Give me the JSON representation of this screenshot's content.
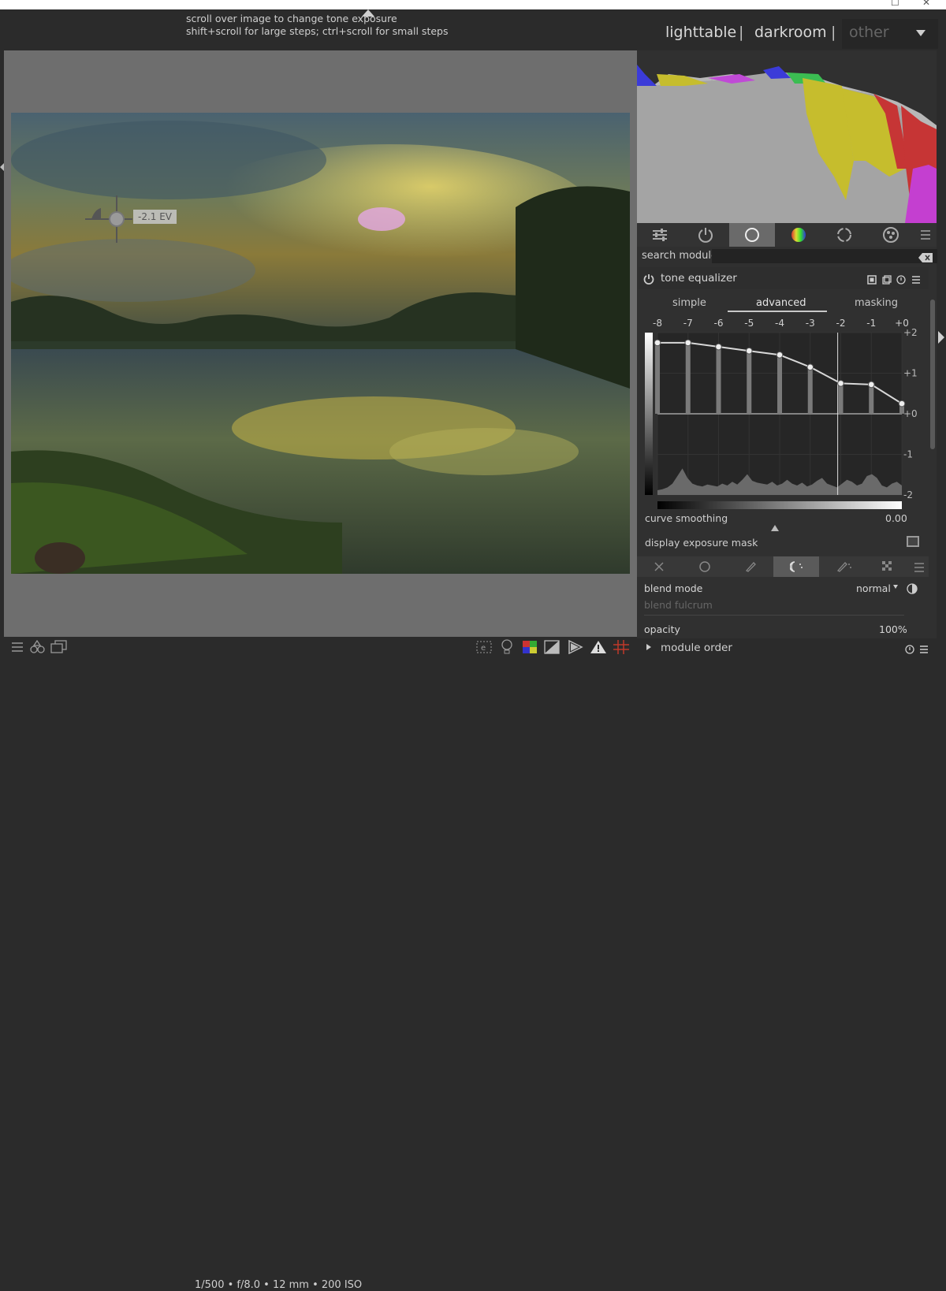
{
  "window": {
    "restore": "☐",
    "close": "✕"
  },
  "tooltip": {
    "line1": "scroll over image to change tone exposure",
    "line2": "shift+scroll for large steps; ctrl+scroll for small steps"
  },
  "views": {
    "lighttable": "lighttable",
    "sep1": "|",
    "darkroom": "darkroom",
    "sep2": "|",
    "other": "other"
  },
  "image": {
    "ev_readout": "-2.1 EV"
  },
  "module_groups": {
    "search_label": "search module",
    "search_value": ""
  },
  "module": {
    "title": "tone equalizer",
    "tabs": [
      "simple",
      "advanced",
      "masking"
    ],
    "active_tab": "advanced",
    "ev_labels": [
      "-8",
      "-7",
      "-6",
      "-5",
      "-4",
      "-3",
      "-2",
      "-1",
      "+0"
    ],
    "gain_labels": [
      "+2",
      "+1",
      "+0",
      "-1",
      "-2"
    ],
    "curve_gains": [
      1.75,
      1.75,
      1.65,
      1.55,
      1.45,
      1.15,
      0.75,
      0.72,
      0.25
    ],
    "cursor_ev": -2.1,
    "curve_smoothing_label": "curve smoothing",
    "curve_smoothing_value": "0.00",
    "display_mask_label": "display exposure mask",
    "blend_mode_label": "blend mode",
    "blend_mode_value": "normal",
    "blend_fulcrum_label": "blend fulcrum",
    "opacity_label": "opacity",
    "opacity_value": "100%"
  },
  "module_order_label": "module order",
  "exif": "1/500 • f/8.0 • 12 mm • 200 ISO"
}
